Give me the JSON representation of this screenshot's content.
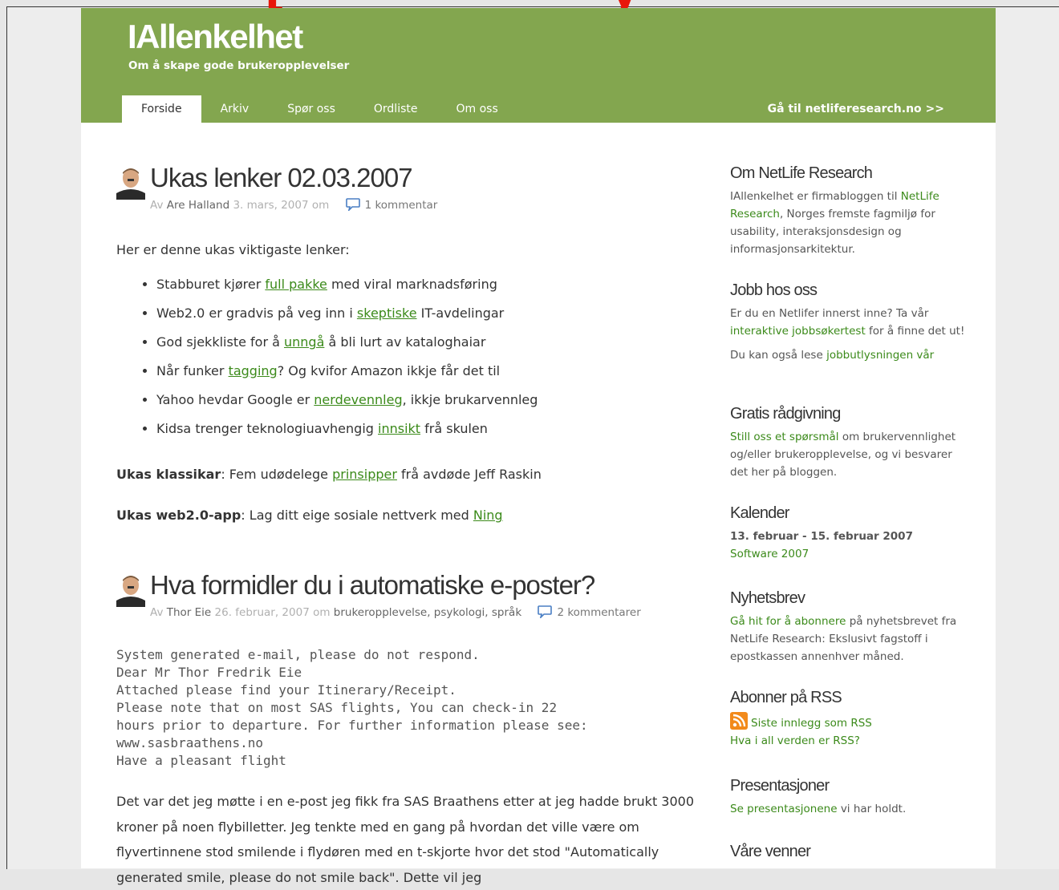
{
  "site": {
    "title": "IAllenkelhet",
    "tagline": "Om å skape gode brukeropplevelser"
  },
  "nav": {
    "items": [
      {
        "label": "Forside",
        "active": true
      },
      {
        "label": "Arkiv"
      },
      {
        "label": "Spør oss"
      },
      {
        "label": "Ordliste"
      },
      {
        "label": "Om oss"
      }
    ],
    "external": "Gå til netliferesearch.no >>"
  },
  "colors": {
    "header": "#83a64f",
    "link": "#3b8a1a",
    "top_fragment": "#e8160a"
  },
  "posts": [
    {
      "title": "Ukas lenker 02.03.2007",
      "author_prefix": "Av",
      "author": "Are Halland",
      "date": "3. mars, 2007 om",
      "comments": "1 kommentar",
      "intro": "Her er denne ukas viktigaste lenker:",
      "links": [
        {
          "before": "Stabburet kjører ",
          "link": "full pakke",
          "after": " med viral marknadsføring"
        },
        {
          "before": "Web2.0 er gradvis på veg inn i ",
          "link": "skeptiske",
          "after": " IT-avdelingar"
        },
        {
          "before": "God sjekkliste for å ",
          "link": "unngå",
          "after": " å bli lurt av kataloghaiar"
        },
        {
          "before": "Når funker ",
          "link": "tagging",
          "after": "? Og kvifor Amazon ikkje får det til"
        },
        {
          "before": "Yahoo hevdar Google er ",
          "link": "nerdevennleg",
          "after": ", ikkje brukarvennleg"
        },
        {
          "before": "Kidsa trenger teknologiuavhengig ",
          "link": "innsikt",
          "after": " frå skulen"
        }
      ],
      "klassikar_label": "Ukas klassikar",
      "klassikar_before": ": Fem udødelege ",
      "klassikar_link": "prinsipper",
      "klassikar_after": " frå avdøde Jeff Raskin",
      "web2_label": "Ukas web2.0-app",
      "web2_before": ": Lag ditt eige sosiale nettverk med ",
      "web2_link": "Ning"
    },
    {
      "title": "Hva formidler du i automatiske e-poster?",
      "author_prefix": "Av",
      "author": "Thor Eie",
      "date": "26. februar, 2007 om",
      "categories": "brukeropplevelse, psykologi, språk",
      "comments": "2 kommentarer",
      "mono": "System generated e-mail, please do not respond.\nDear Mr Thor Fredrik Eie\nAttached please find your Itinerary/Receipt.\nPlease note that on most SAS flights, You can check-in 22\nhours prior to departure. For further information please see:\nwww.sasbraathens.no\nHave a pleasant flight",
      "body": "Det var det jeg møtte i en e-post jeg fikk fra SAS Braathens etter at jeg hadde brukt 3000 kroner på noen flybilletter. Jeg tenkte med en gang på hvordan det ville være om flyvertinnene stod smilende i flydøren med en t-skjorte hvor det stod \"Automatically generated smile, please do not smile back\". Dette vil jeg"
    }
  ],
  "sidebar": {
    "om": {
      "title": "Om NetLife Research",
      "t1": "IAllenkelhet er firmabloggen til ",
      "link": "NetLife Research",
      "t2": ", Norges fremste fagmiljø for usability, interaksjonsdesign og informasjonsarkitektur."
    },
    "jobb": {
      "title": "Jobb hos oss",
      "t1": "Er du en Netlifer innerst inne? Ta vår ",
      "link": "interaktive jobbsøkertest",
      "t2": " for å finne det ut!",
      "t3": "Du kan også lese ",
      "link2": "jobbutlysningen vår"
    },
    "gratis": {
      "title": "Gratis rådgivning",
      "link": "Still oss et spørsmål",
      "t1": " om brukervennlighet og/eller brukeropplevelse, og vi besvarer det her på bloggen."
    },
    "kalender": {
      "title": "Kalender",
      "date": "13. februar - 15. februar 2007",
      "link": "Software 2007"
    },
    "nyhetsbrev": {
      "title": "Nyhetsbrev",
      "link": "Gå hit for å abonnere",
      "t1": " på nyhetsbrevet fra NetLife Research: Ekslusivt fagstoff i epostkassen annenhver måned."
    },
    "rss": {
      "title": "Abonner på RSS",
      "link": "Siste innlegg som RSS",
      "link2": "Hva i all verden er RSS?"
    },
    "presentasjoner": {
      "title": "Presentasjoner",
      "link": "Se presentasjonene",
      "t1": " vi har holdt."
    },
    "venner": {
      "title": "Våre venner"
    }
  }
}
